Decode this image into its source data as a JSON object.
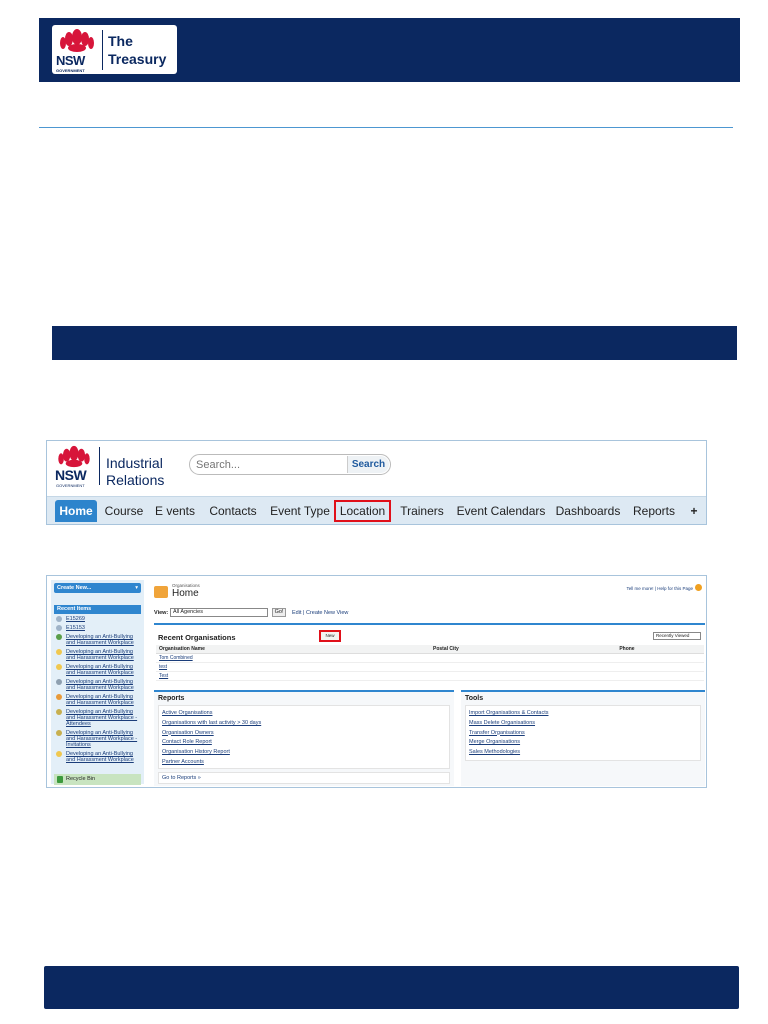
{
  "doc_header": {
    "org_line1": "The",
    "org_line2": "Treasury",
    "logo_text": "NSW",
    "logo_sub": "GOVERNMENT"
  },
  "tab_screenshot": {
    "logo_text": "NSW",
    "logo_sub": "GOVERNMENT",
    "org_line1": "Industrial",
    "org_line2": "Relations",
    "search_placeholder": "Search...",
    "search_button": "Search",
    "tabs": [
      "Home",
      "Course",
      "E vents",
      "Contacts",
      "Event Type",
      "Location",
      "Trainers",
      "Event Calendars",
      "Dashboards",
      "Reports"
    ],
    "more_tab": "+",
    "active_tab": "Home",
    "highlighted_tab": "Location"
  },
  "orgs_screenshot": {
    "sidebar": {
      "create_new": "Create New...",
      "recent_items_title": "Recent Items",
      "recent_items": [
        "E15269",
        "E15153",
        "Developing an Anti-Bullying and Harassment Workplace",
        "Developing an Anti-Bullying and Harassment Workplace",
        "Developing an Anti-Bullying and Harassment Workplace",
        "Developing an Anti-Bullying and Harassment Workplace",
        "Developing an Anti-Bullying and Harassment Workplace",
        "Developing an Anti-Bullying and Harassment Workplace - Attendees",
        "Developing an Anti-Bullying and Harassment Workplace - Invitations",
        "Developing an Anti-Bullying and Harassment Workplace"
      ],
      "recycle_bin": "Recycle Bin"
    },
    "header": {
      "eyebrow": "Organisations",
      "title": "Home",
      "help_link": "Tell me more! | Help for this Page"
    },
    "view": {
      "label": "View:",
      "selected": "All Agencies",
      "go": "Go!",
      "edit_links": "Edit | Create New View"
    },
    "recent_orgs": {
      "title": "Recent Organisations",
      "new_button": "New",
      "sort_select": "Recently Viewed",
      "columns": [
        "Organisation Name",
        "Postal City",
        "Phone"
      ],
      "rows": [
        [
          "Tom Combined",
          "",
          ""
        ],
        [
          "test",
          "",
          ""
        ],
        [
          "Test",
          "",
          ""
        ]
      ]
    },
    "reports": {
      "title": "Reports",
      "items": [
        "Active Organisations",
        "Organisations with last activity > 30 days",
        "Organisation Owners",
        "Contact Role Report",
        "Organisation History Report",
        "Partner Accounts"
      ],
      "go_to": "Go to Reports »"
    },
    "tools": {
      "title": "Tools",
      "items": [
        "Import Organisations & Contacts",
        "Mass Delete Organisations",
        "Transfer Organisations",
        "Merge Organisations",
        "Sales Methodologies"
      ]
    }
  },
  "colors": {
    "navy": "#0b2860",
    "accent_blue": "#2d84cc",
    "highlight_red": "#e0101a",
    "waratah_red": "#d7153a"
  }
}
